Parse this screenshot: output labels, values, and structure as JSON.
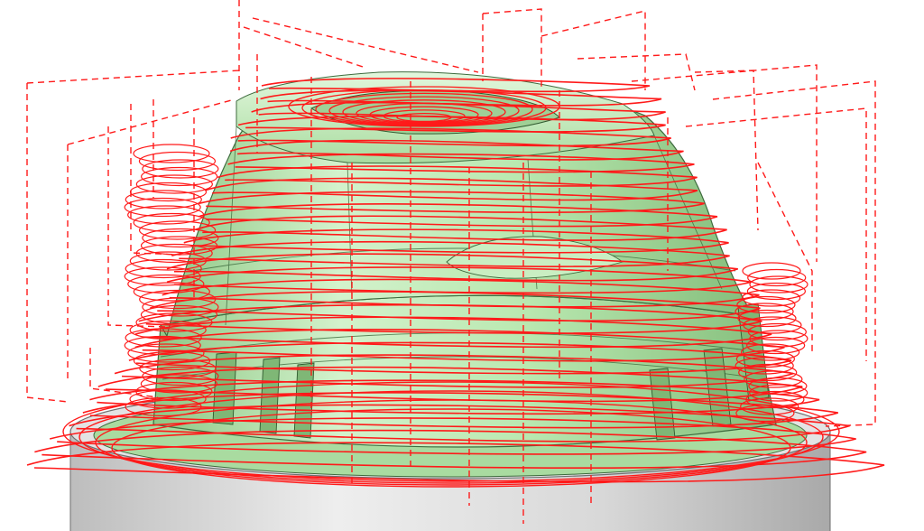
{
  "scene": {
    "title": "",
    "background": "#ffffff",
    "colors": {
      "toolpath": "#ff1a1a",
      "model_face": "#b9e8b0",
      "model_edge": "#3e6b3e",
      "stock_face": "#dcdcdc",
      "stock_edge": "#6f6f6f"
    },
    "objects": [
      {
        "id": "stock",
        "kind": "cylinder stock",
        "color": "#dcdcdc"
      },
      {
        "id": "model",
        "kind": "machined part",
        "color": "#b9e8b0"
      },
      {
        "id": "contours",
        "kind": "toolpath cutting moves",
        "style": "solid",
        "color": "#ff1a1a"
      },
      {
        "id": "links",
        "kind": "toolpath rapid moves",
        "style": "dashed",
        "color": "#ff1a1a"
      }
    ]
  }
}
